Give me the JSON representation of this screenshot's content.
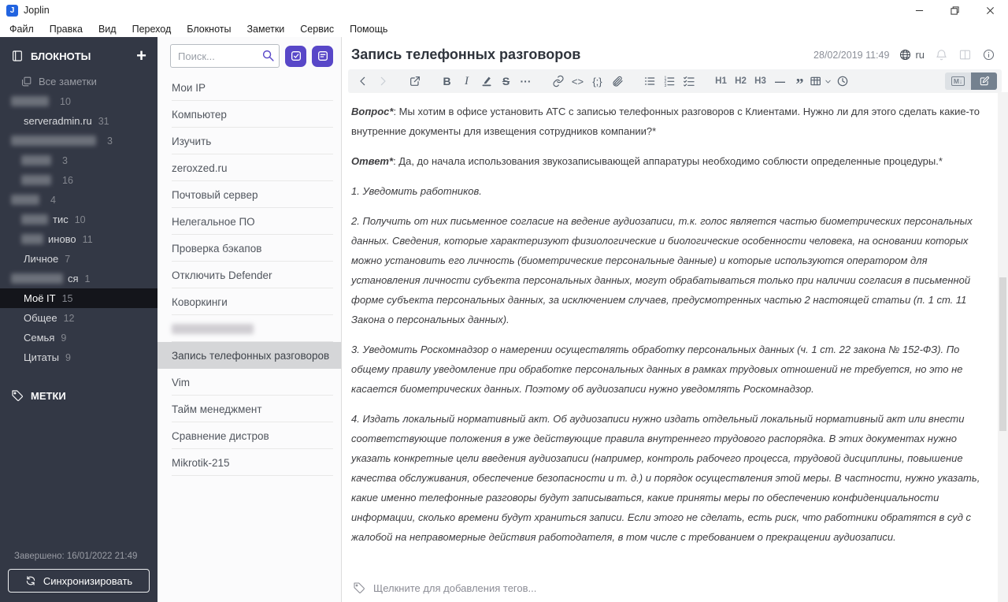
{
  "colors": {
    "accent": "#5847c8",
    "sidebar-bg": "#333845",
    "sidebar-selected-bg": "#14151b",
    "note-selected-bg": "#d5d6d8",
    "toolbar-bg": "#f2f3f4",
    "toolbar-icon": "#55606d",
    "toggle-active-bg": "#74818f",
    "logo-blue": "#2264e0"
  },
  "window": {
    "app_title": "Joplin"
  },
  "menu": [
    "Файл",
    "Правка",
    "Вид",
    "Переход",
    "Блокноты",
    "Заметки",
    "Сервис",
    "Помощь"
  ],
  "sidebar": {
    "notebooks_header": "БЛОКНОТЫ",
    "all_notes_label": "Все заметки",
    "plus_label": "+",
    "notebooks": [
      {
        "redact": 48,
        "count": "10",
        "indent": 1
      },
      {
        "label": "serveradmin.ru",
        "count": "31",
        "indent": 1
      },
      {
        "redact": 108,
        "count": "3",
        "indent": 1
      },
      {
        "redact": 38,
        "count": "3",
        "indent": 2
      },
      {
        "redact": 38,
        "count": "16",
        "indent": 2
      },
      {
        "redact": 36,
        "count": "4",
        "indent": 1
      },
      {
        "redact": 34,
        "suffix": "тис",
        "count": "10",
        "indent": 2
      },
      {
        "redact": 28,
        "suffix": "иново",
        "count": "11",
        "indent": 2
      },
      {
        "label": "Личное",
        "count": "7",
        "indent": 1
      },
      {
        "redact": 66,
        "suffix": "ся",
        "count": "1",
        "indent": 1
      },
      {
        "label": "Моё IT",
        "count": "15",
        "indent": 1,
        "selected": true
      },
      {
        "label": "Общее",
        "count": "12",
        "indent": 1
      },
      {
        "label": "Семья",
        "count": "9",
        "indent": 1
      },
      {
        "label": "Цитаты",
        "count": "9",
        "indent": 1
      }
    ],
    "tags_header": "МЕТКИ",
    "sync_status": "Завершено: 16/01/2022 21:49",
    "sync_button_label": "Синхронизировать"
  },
  "notelist": {
    "search_placeholder": "Поиск...",
    "notes": [
      {
        "label": "Мои IP"
      },
      {
        "label": "Компьютер"
      },
      {
        "label": "Изучить"
      },
      {
        "label": "zeroxzed.ru"
      },
      {
        "label": "Почтовый сервер"
      },
      {
        "label": "Нелегальное ПО"
      },
      {
        "label": "Проверка бэкапов"
      },
      {
        "label": "Отключить Defender"
      },
      {
        "label": "Коворкинги"
      },
      {
        "redact": 104
      },
      {
        "label": "Запись телефонных разговоров",
        "selected": true
      },
      {
        "label": "Vim"
      },
      {
        "label": "Тайм менеджмент"
      },
      {
        "label": "Сравнение дистров"
      },
      {
        "label": "Mikrotik-215"
      }
    ]
  },
  "editor": {
    "title": "Запись телефонных разговоров",
    "date": "28/02/2019 11:49",
    "locale": "ru",
    "toolbar": [
      {
        "name": "back-icon",
        "glyph": "chevL"
      },
      {
        "name": "forward-icon",
        "glyph": "chevR",
        "disabled": true
      },
      {
        "name": "external-link-icon",
        "glyph": "ext",
        "gap": true
      },
      {
        "name": "bold-icon",
        "text": "B",
        "cls": "tb-b",
        "gap": true
      },
      {
        "name": "italic-icon",
        "text": "I",
        "cls": "tb-it"
      },
      {
        "name": "highlight-icon",
        "glyph": "pen"
      },
      {
        "name": "strikethrough-icon",
        "text": "S",
        "cls": "tb-s"
      },
      {
        "name": "more-options-icon",
        "text": "···",
        "cls": "tb-b"
      },
      {
        "name": "hyperlink-icon",
        "glyph": "link",
        "gap": true
      },
      {
        "name": "inline-code-icon",
        "text": "<>"
      },
      {
        "name": "code-block-icon",
        "text": "{;}"
      },
      {
        "name": "attach-file-icon",
        "glyph": "clip"
      },
      {
        "name": "bulleted-list-icon",
        "glyph": "ul",
        "gap": true
      },
      {
        "name": "numbered-list-icon",
        "glyph": "ol"
      },
      {
        "name": "checkbox-list-icon",
        "glyph": "cl"
      },
      {
        "name": "heading1-button",
        "text": "H1",
        "cls": "tb-h",
        "gap": true
      },
      {
        "name": "heading2-button",
        "text": "H2",
        "cls": "tb-h"
      },
      {
        "name": "heading3-button",
        "text": "H3",
        "cls": "tb-h"
      },
      {
        "name": "horizontal-rule-icon",
        "text": "—",
        "cls": "tb-dash"
      },
      {
        "name": "blockquote-icon",
        "text": "”",
        "cls": "tb-quote"
      },
      {
        "name": "insert-table-icon",
        "glyph": "tableCaret"
      },
      {
        "name": "insert-datetime-icon",
        "glyph": "clock"
      }
    ],
    "paragraphs": [
      {
        "kind": "qa",
        "label": "Вопрос*",
        "text": ": Мы хотим в офисе установить АТС с записью телефонных разговоров с Клиентами. Нужно ли для этого сделать какие-то внутренние документы для извещения сотрудников компании?*"
      },
      {
        "kind": "qa",
        "label": "Ответ*",
        "text": ": Да, до начала использования звукозаписывающей аппаратуры необходимо соблюсти определенные процедуры.*"
      },
      {
        "kind": "num",
        "text": "1. Уведомить работников."
      },
      {
        "kind": "num",
        "text": "2. Получить от них письменное согласие на ведение аудиозаписи, т.к. голос является частью биометрических персональных данных. Сведения, которые характеризуют физиологические и биологические особенности человека, на основании которых можно установить его личность (биометрические персональные данные) и которые используются оператором для установления личности субъекта персональных данных, могут обрабатываться только при наличии согласия в письменной форме субъекта персональных данных, за исключением случаев, предусмотренных частью 2 настоящей статьи (п. 1 ст. 11 Закона о персональных данных)."
      },
      {
        "kind": "num",
        "text": "3. Уведомить Роскомнадзор о намерении осуществлять обработку персональных данных (ч. 1 ст. 22 закона № 152-ФЗ). По общему правилу уведомление при обработке персональных данных в рамках трудовых отношений не требуется, но это не касается биометрических данных. Поэтому об аудиозаписи нужно уведомлять Роскомнадзор."
      },
      {
        "kind": "num",
        "text": "4. Издать локальный нормативный акт. Об аудиозаписи нужно издать отдельный локальный нормативный акт или внести соответствующие положения в уже действующие правила внутреннего трудового распорядка. В этих документах нужно указать конкретные цели введения аудиозаписи (например, контроль рабочего процесса, трудовой дисциплины, повышение качества обслуживания, обеспечение безопасности и т. д.) и порядок осуществления этой меры. В частности, нужно указать, какие именно телефонные разговоры будут записываться, какие приняты меры по обеспечению конфиденциальности информации, сколько времени будут храниться записи. Если этого не сделать, есть риск, что работники обратятся в суд с жалобой на неправомерные действия работодателя, в том числе с требованием о прекращении аудиозаписи."
      }
    ],
    "tags_placeholder": "Щелкните для добавления тегов..."
  }
}
